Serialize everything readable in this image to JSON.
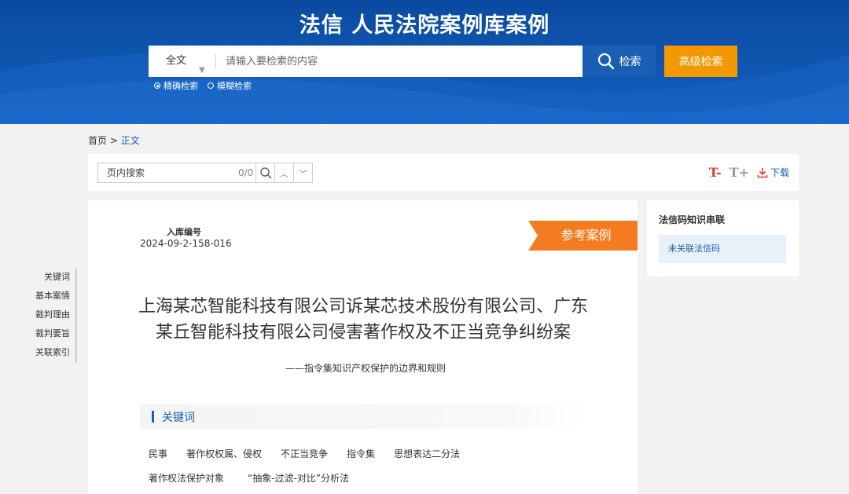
{
  "header": {
    "site_title": "法信 人民法院案例库案例",
    "search": {
      "scope_value": "全文",
      "placeholder": "请输入要检索的内容",
      "button_label": "检索",
      "advanced_label": "高级检索"
    },
    "modes": [
      {
        "label": "精确检索",
        "selected": true
      },
      {
        "label": "模糊检索",
        "selected": false
      }
    ],
    "colors": {
      "brand_blue": "#0a4ba0",
      "accent_orange": "#f39800"
    }
  },
  "breadcrumb": {
    "home": "首页",
    "separator": ">",
    "current": "正文"
  },
  "toolbar": {
    "page_search_placeholder": "页内搜索",
    "page_search_count": "0/0",
    "font_decrease": "T-",
    "font_increase": "T+",
    "download_label": "下载"
  },
  "left_nav": [
    "关键词",
    "基本案情",
    "裁判理由",
    "裁判要旨",
    "关联索引"
  ],
  "article": {
    "library_no_label": "入库编号",
    "library_no": "2024-09-2-158-016",
    "tag": "参考案例",
    "title_line1": "上海某芯智能科技有限公司诉某芯技术股份有限公司、广东",
    "title_line2": "某丘智能科技有限公司侵害著作权及不正当竞争纠纷案",
    "subtitle": "——指令集知识产权保护的边界和规则",
    "keywords_heading": "关键词",
    "keywords_row1": [
      "民事",
      "著作权权属、侵权",
      "不正当竞争",
      "指令集",
      "思想表达二分法"
    ],
    "keywords_row2": [
      "著作权法保护对象",
      "“抽象-过滤-对比”分析法"
    ]
  },
  "side_panel": {
    "title": "法信码知识串联",
    "item": "未关联法信码"
  }
}
